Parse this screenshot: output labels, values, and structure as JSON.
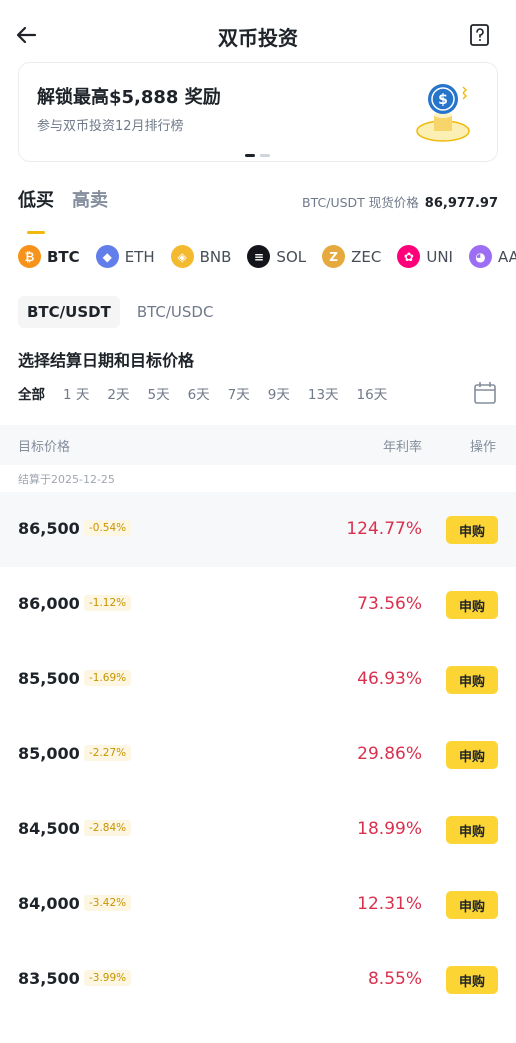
{
  "header": {
    "title": "双币投资"
  },
  "banner": {
    "title": "解锁最高$5,888 奖励",
    "subtitle": "参与双币投资12月排行榜"
  },
  "tabs": [
    {
      "label": "低买",
      "active": true
    },
    {
      "label": "高卖",
      "active": false
    }
  ],
  "spot": {
    "label": "BTC/USDT 现货价格",
    "value": "86,977.97"
  },
  "coins": [
    {
      "symbol": "BTC",
      "icon": "bitcoin-icon",
      "color": "#f7931a",
      "glyph": "₿",
      "active": true
    },
    {
      "symbol": "ETH",
      "icon": "ethereum-icon",
      "color": "#627eea",
      "glyph": "◆",
      "active": false
    },
    {
      "symbol": "BNB",
      "icon": "bnb-icon",
      "color": "#f3ba2f",
      "glyph": "◈",
      "active": false
    },
    {
      "symbol": "SOL",
      "icon": "solana-icon",
      "color": "#14151a",
      "glyph": "≡",
      "active": false
    },
    {
      "symbol": "ZEC",
      "icon": "zcash-icon",
      "color": "#e5a93d",
      "glyph": "Z",
      "active": false
    },
    {
      "symbol": "UNI",
      "icon": "uniswap-icon",
      "color": "#ff007a",
      "glyph": "✿",
      "active": false
    },
    {
      "symbol": "AA",
      "icon": "coin-icon",
      "color": "#9b6ef3",
      "glyph": "◕",
      "active": false
    }
  ],
  "pairs": [
    {
      "label": "BTC/USDT",
      "active": true
    },
    {
      "label": "BTC/USDC",
      "active": false
    }
  ],
  "section_title": "选择结算日期和目标价格",
  "days": [
    {
      "label": "全部",
      "active": true
    },
    {
      "label": "1 天",
      "active": false
    },
    {
      "label": "2天",
      "active": false
    },
    {
      "label": "5天",
      "active": false
    },
    {
      "label": "6天",
      "active": false
    },
    {
      "label": "7天",
      "active": false
    },
    {
      "label": "9天",
      "active": false
    },
    {
      "label": "13天",
      "active": false
    },
    {
      "label": "16天",
      "active": false
    }
  ],
  "table": {
    "col_price": "目标价格",
    "col_apr": "年利率",
    "col_action": "操作",
    "settle_label": "结算于2025-12-25",
    "rows": [
      {
        "price": "86,500",
        "change": "-0.54%",
        "apr": "124.77%",
        "action": "申购"
      },
      {
        "price": "86,000",
        "change": "-1.12%",
        "apr": "73.56%",
        "action": "申购"
      },
      {
        "price": "85,500",
        "change": "-1.69%",
        "apr": "46.93%",
        "action": "申购"
      },
      {
        "price": "85,000",
        "change": "-2.27%",
        "apr": "29.86%",
        "action": "申购"
      },
      {
        "price": "84,500",
        "change": "-2.84%",
        "apr": "18.99%",
        "action": "申购"
      },
      {
        "price": "84,000",
        "change": "-3.42%",
        "apr": "12.31%",
        "action": "申购"
      },
      {
        "price": "83,500",
        "change": "-3.99%",
        "apr": "8.55%",
        "action": "申购"
      }
    ]
  },
  "colors": {
    "accent": "#fcd535",
    "rate": "#d9304e",
    "tab_indicator": "#f0b90b"
  }
}
